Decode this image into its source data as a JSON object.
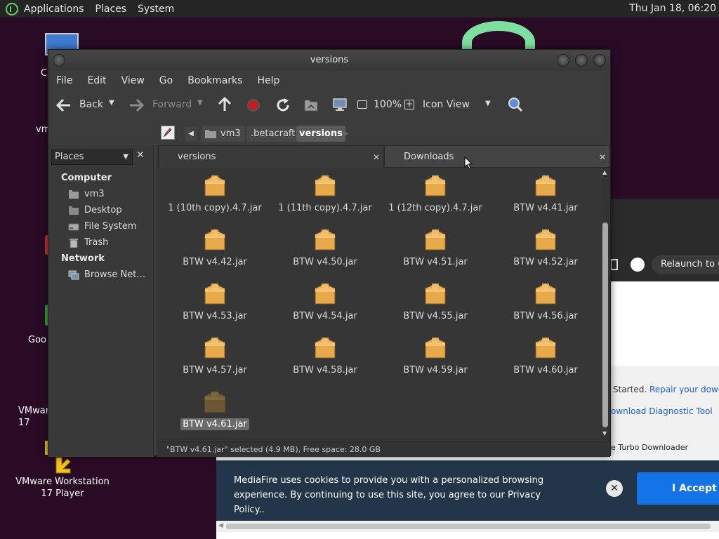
{
  "top_panel": {
    "menus": [
      "Applications",
      "Places",
      "System"
    ],
    "clock": "Thu Jan 18, 06:20"
  },
  "desktop": {
    "icons": [
      {
        "label": "C"
      },
      {
        "label": "vm"
      },
      {
        "label": "Goo"
      },
      {
        "label": "VMware\n17"
      },
      {
        "label": "VMware Workstation\n17 Player"
      }
    ]
  },
  "browser": {
    "relaunch_label": "Relaunch to up",
    "started_text": "Started.",
    "repair_link": "Repair your downloa",
    "diagnostic_link": "ownload Diagnostic Tool",
    "turbo_text": "e Turbo Downloader"
  },
  "cookie_banner": {
    "text": "MediaFire uses cookies to provide you with a personalized browsing experience. By continuing to use this site, you agree to our Privacy Policy..",
    "close_glyph": "✕",
    "accept_label": "I Accept"
  },
  "window": {
    "title": "versions",
    "menu": [
      "File",
      "Edit",
      "View",
      "Go",
      "Bookmarks",
      "Help"
    ],
    "toolbar": {
      "back_label": "Back",
      "forward_label": "Forward",
      "zoom": "100%",
      "view_mode": "Icon View"
    },
    "breadcrumb": [
      "vm3",
      ".betacraft",
      "versions"
    ],
    "sidebar": {
      "selector": "Places",
      "sections": [
        {
          "header": "Computer",
          "items": [
            "vm3",
            "Desktop",
            "File System",
            "Trash"
          ]
        },
        {
          "header": "Network",
          "items": [
            "Browse Net…"
          ]
        }
      ]
    },
    "tabs": [
      "versions",
      "Downloads"
    ],
    "files": [
      "1 (10th copy).4.7.jar",
      "1 (11th copy).4.7.jar",
      "1 (12th copy).4.7.jar",
      "BTW v4.41.jar",
      "BTW v4.42.jar",
      "BTW v4.50.jar",
      "BTW v4.51.jar",
      "BTW v4.52.jar",
      "BTW v4.53.jar",
      "BTW v4.54.jar",
      "BTW v4.55.jar",
      "BTW v4.56.jar",
      "BTW v4.57.jar",
      "BTW v4.58.jar",
      "BTW v4.59.jar",
      "BTW v4.60.jar",
      "BTW v4.61.jar"
    ],
    "selected_file": "BTW v4.61.jar",
    "status": "\"BTW v4.61.jar\" selected (4.9 MB), Free space: 28.0 GB"
  },
  "colors": {
    "folder": "#e8a94a",
    "accent_blue": "#1473e6",
    "window_bg": "#3c3c3c"
  }
}
